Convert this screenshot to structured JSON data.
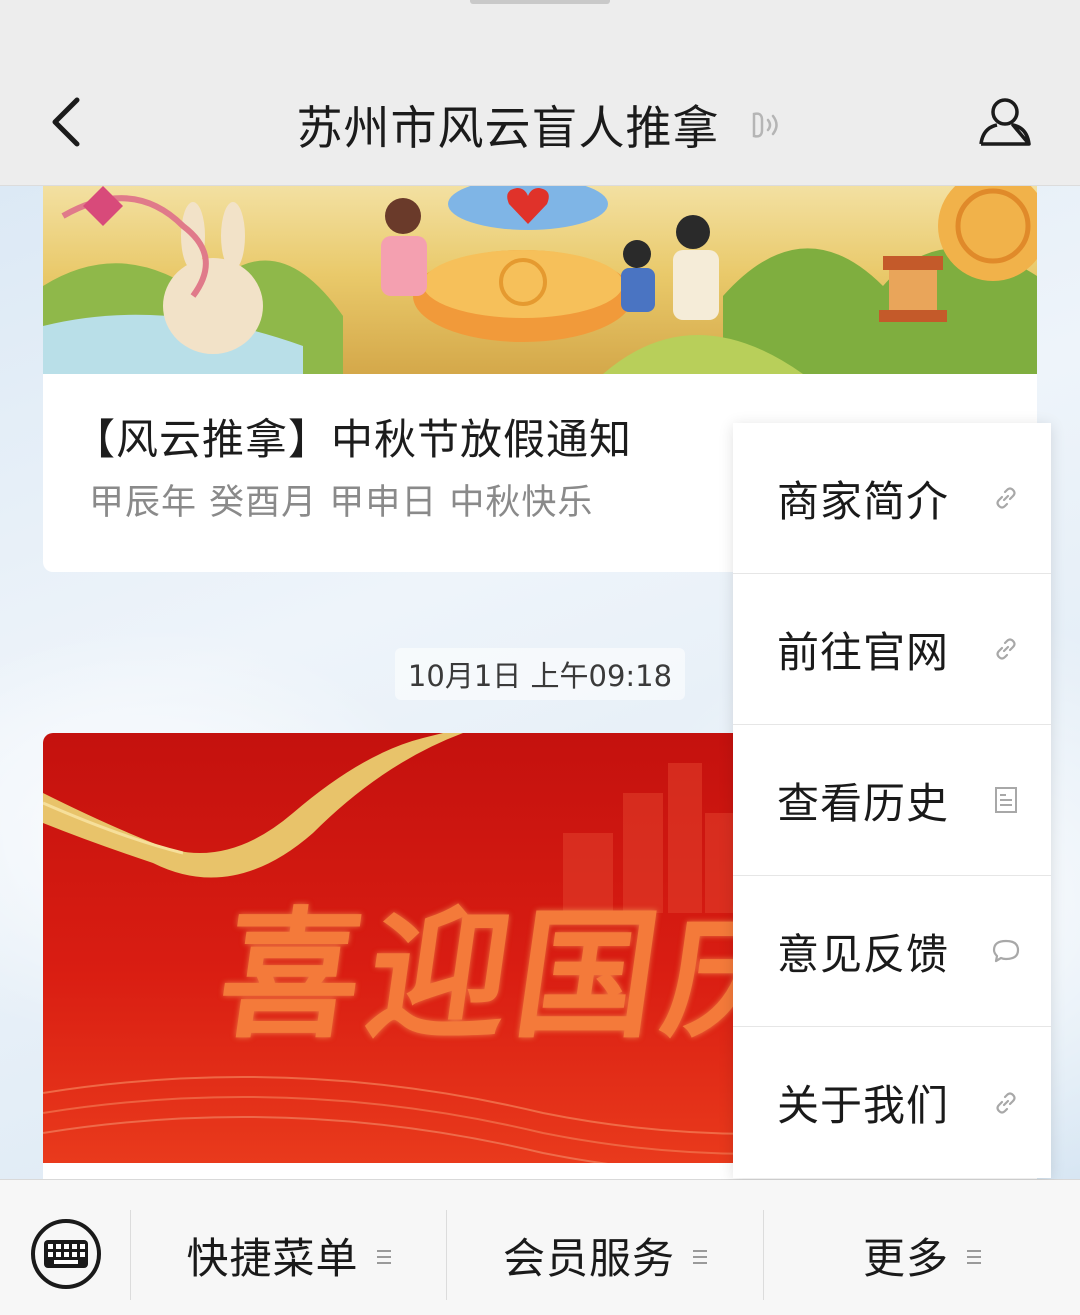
{
  "header": {
    "title": "苏州市风云盲人推拿",
    "back_icon": "chevron-left-icon",
    "voice_icon": "speaker-icon",
    "profile_icon": "person-icon"
  },
  "messages": [
    {
      "title": "【风云推拿】中秋节放假通知",
      "subtitle": "甲辰年 癸酉月 甲申日 中秋快乐"
    },
    {
      "timestamp": "10月1日 上午09:18",
      "banner_text": "喜迎国庆"
    }
  ],
  "popup_menu": {
    "items": [
      {
        "label": "商家简介",
        "icon": "link-icon"
      },
      {
        "label": "前往官网",
        "icon": "link-icon"
      },
      {
        "label": "查看历史",
        "icon": "document-icon"
      },
      {
        "label": "意见反馈",
        "icon": "chat-bubble-icon"
      },
      {
        "label": "关于我们",
        "icon": "link-icon"
      }
    ]
  },
  "bottom_menu": {
    "keyboard_icon": "keyboard-icon",
    "items": [
      {
        "label": "快捷菜单",
        "icon": "menu-lines-icon"
      },
      {
        "label": "会员服务",
        "icon": "menu-lines-icon"
      },
      {
        "label": "更多",
        "icon": "menu-lines-icon"
      }
    ]
  },
  "colors": {
    "header_bg": "#ededed",
    "festival_red": "#d91d12",
    "gold": "#e8c36a"
  }
}
